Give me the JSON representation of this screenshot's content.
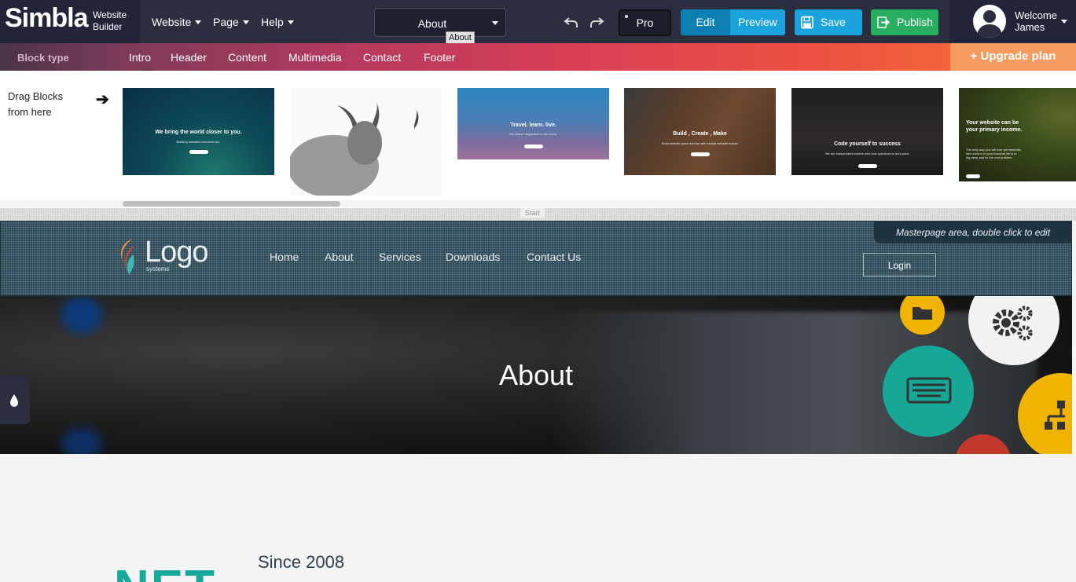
{
  "app": {
    "brand_name": "Simbla",
    "brand_sub_line1": "Website",
    "brand_sub_line2": "Builder"
  },
  "menu": {
    "website": "Website",
    "page": "Page",
    "help": "Help"
  },
  "page_selector": {
    "value": "About",
    "tooltip": "About"
  },
  "toolbar": {
    "pro_label": "Pro",
    "edit_label": "Edit",
    "preview_label": "Preview",
    "save_label": "Save",
    "publish_label": "Publish"
  },
  "user": {
    "welcome": "Welcome",
    "name": "James"
  },
  "categories": {
    "title": "Block type",
    "items": [
      "Intro",
      "Header",
      "Content",
      "Multimedia",
      "Contact",
      "Footer"
    ],
    "active": "Intro"
  },
  "upgrade_label": "+ Upgrade plan",
  "blocks_panel": {
    "drag_line1": "Drag Blocks",
    "drag_line2": "from here",
    "thumbs": [
      {
        "headline": "We bring the world closer to you.",
        "sub": "Building websites becomes fun."
      },
      {
        "headline": "",
        "sub": ""
      },
      {
        "headline": "Travel. learn. live.",
        "sub": "We deliver happiness to the world."
      },
      {
        "headline": "Build , Create , Make",
        "sub": "Build website quick and fun with simbla website builder"
      },
      {
        "headline": "Code yourself to success",
        "sub": "We are independent coders who love opensource and pizza."
      },
      {
        "headline": "Your website can be your primary income.",
        "sub": "The only way you will ever permanently take control of your financial life is to dig deep and fix the root problem."
      }
    ]
  },
  "canvas": {
    "start_label": "Start",
    "masterpage_note": "Masterpage area, double click to edit",
    "logo_text": "Logo",
    "logo_sub": "systems",
    "nav": [
      "Home",
      "About",
      "Services",
      "Downloads",
      "Contact Us"
    ],
    "login_label": "Login",
    "hero_title": "About",
    "since": "Since 2008",
    "net_text": "NET"
  },
  "colors": {
    "topbar": "#2b2e3e",
    "edit": "#0e7fb2",
    "preview": "#1aa3dc",
    "save": "#1aa3dc",
    "publish": "#27ae60",
    "upgrade": "#f59b5f",
    "teal_accent": "#17a99a"
  }
}
